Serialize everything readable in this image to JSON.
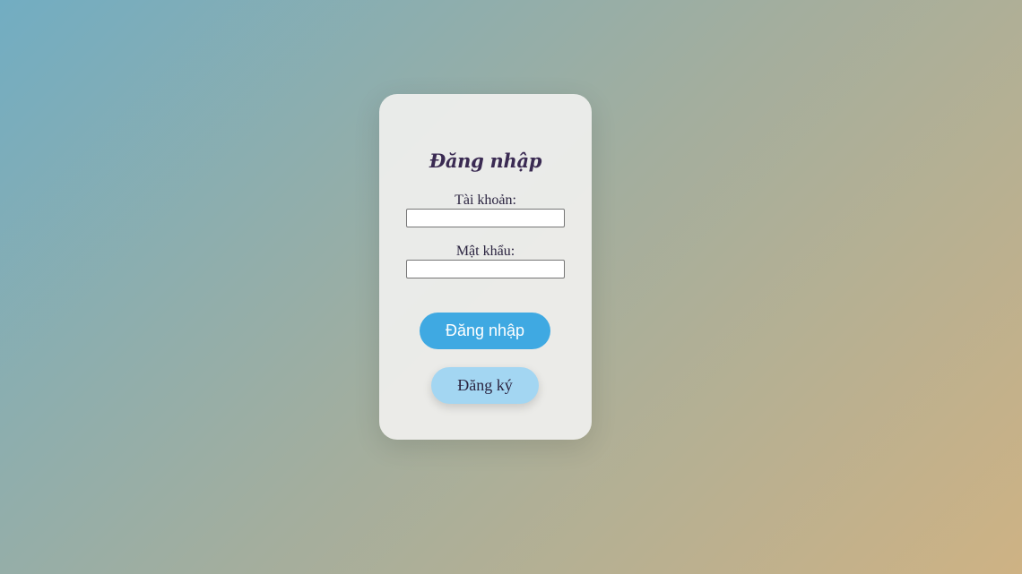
{
  "login_card": {
    "title": "Đăng nhập",
    "username": {
      "label": "Tài khoản:",
      "value": "",
      "placeholder": ""
    },
    "password": {
      "label": "Mật khẩu:",
      "value": "",
      "placeholder": ""
    },
    "login_button_label": "Đăng nhập",
    "register_button_label": "Đăng ký"
  },
  "colors": {
    "primary_button": "#3fa9e2",
    "secondary_button": "#a3d6f2",
    "text": "#2b2440",
    "background_start": "#72adc2",
    "background_end": "#ceb284"
  }
}
